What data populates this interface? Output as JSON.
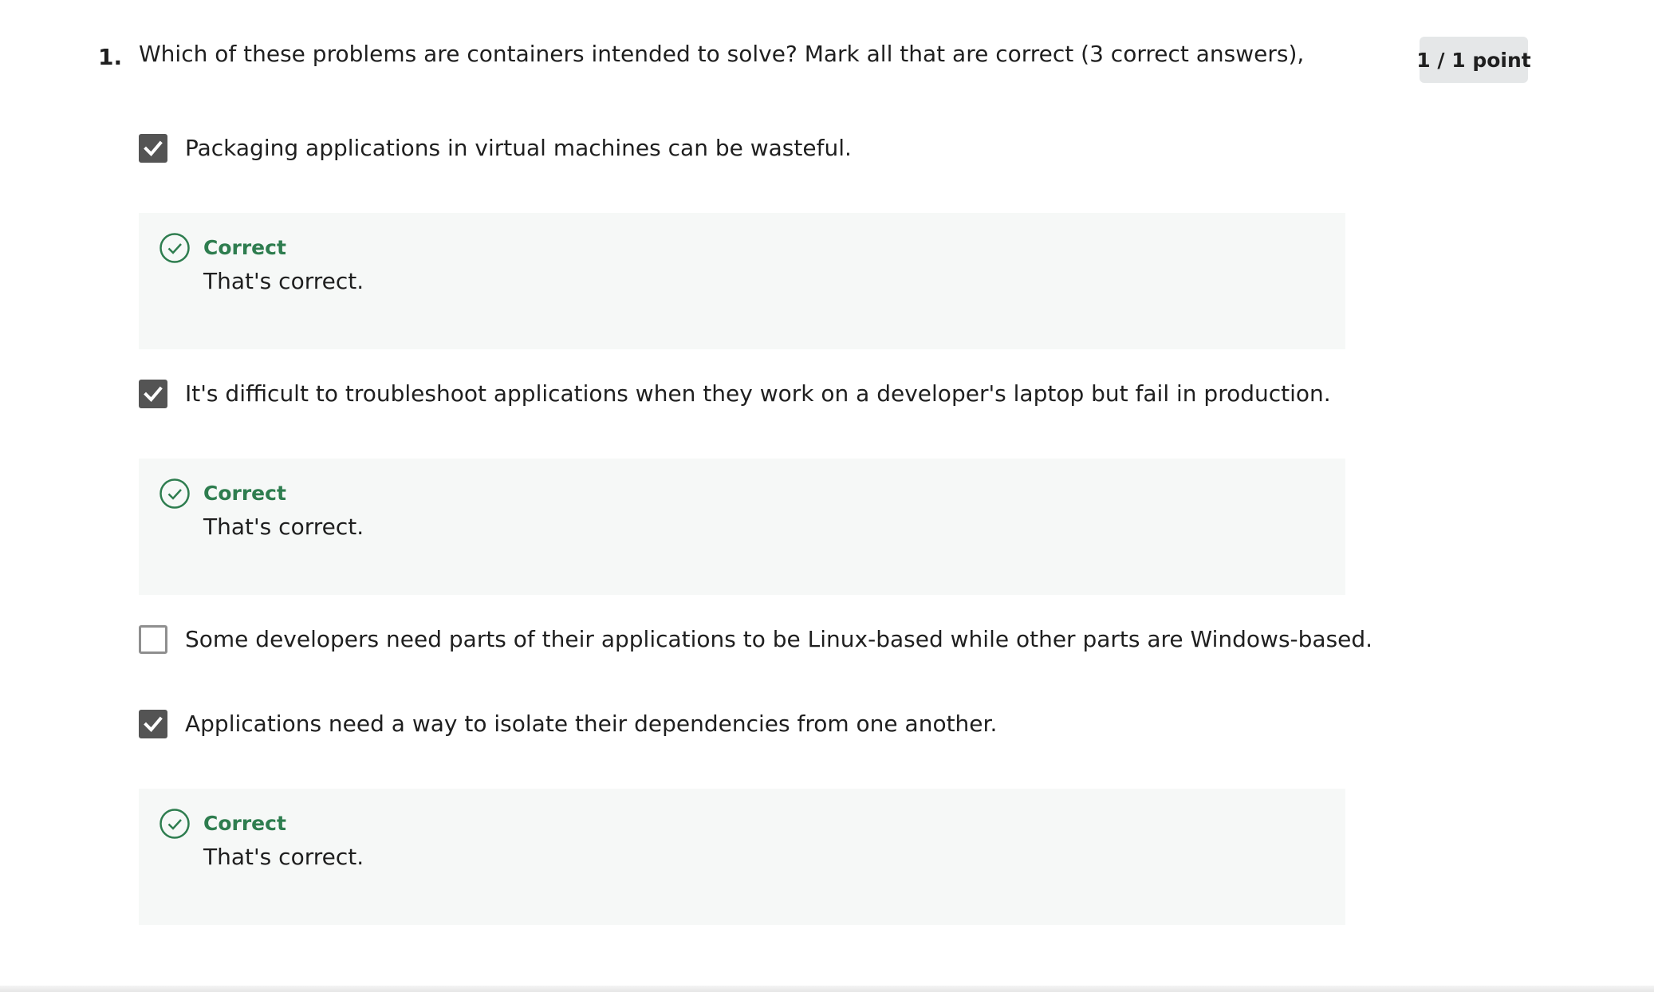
{
  "question": {
    "number": "1.",
    "text": "Which of these problems are containers intended to solve? Mark all that are correct (3 correct answers),",
    "points": "1 / 1 point"
  },
  "options": [
    {
      "text": "Packaging applications in virtual machines can be wasteful.",
      "checked": true,
      "feedback": {
        "label": "Correct",
        "text": "That's correct."
      }
    },
    {
      "text": "It's difficult to troubleshoot applications when they work on a developer's laptop but fail in production.",
      "checked": true,
      "feedback": {
        "label": "Correct",
        "text": "That's correct."
      }
    },
    {
      "text": "Some developers need parts of their applications to be Linux-based while other parts are Windows-based.",
      "checked": false
    },
    {
      "text": "Applications need a way to isolate their dependencies from one another.",
      "checked": true,
      "feedback": {
        "label": "Correct",
        "text": "That's correct."
      }
    }
  ],
  "colors": {
    "correct_green": "#2e7d4f",
    "checkbox_checked": "#545454",
    "feedback_bg": "#f6f8f7",
    "badge_bg": "#e5e7e8"
  },
  "icons": {
    "checked": "checkmark-icon",
    "feedback": "check-circle-icon"
  }
}
